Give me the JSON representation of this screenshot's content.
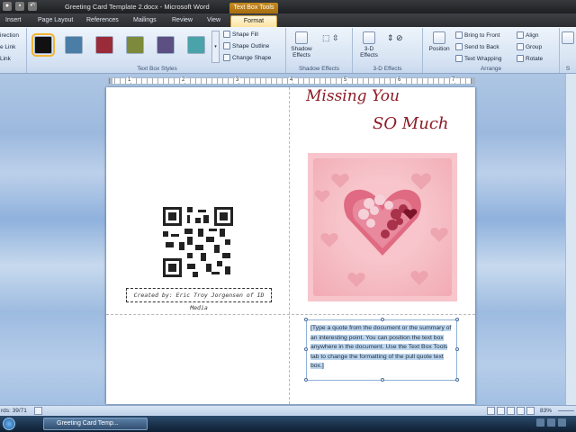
{
  "window": {
    "title": "Greeting Card Template 2.docx - Microsoft Word",
    "contextual_tab": "Text Box Tools"
  },
  "tabs": [
    {
      "label": "Insert"
    },
    {
      "label": "Page Layout"
    },
    {
      "label": "References"
    },
    {
      "label": "Mailings"
    },
    {
      "label": "Review"
    },
    {
      "label": "View"
    },
    {
      "label": "Format"
    }
  ],
  "ribbon": {
    "text_group": {
      "direction": "irection",
      "link": "e Link",
      "break_link": "Link"
    },
    "text_box_styles": {
      "label": "Text Box Styles",
      "swatches": [
        "#111111",
        "#4a7ea6",
        "#9a2c3a",
        "#7d8a3c",
        "#5c4f82",
        "#4aa3a8"
      ],
      "shape_fill": "Shape Fill",
      "shape_outline": "Shape Outline",
      "change_shape": "Change Shape"
    },
    "shadow_effects": {
      "label": "Shadow Effects",
      "button": "Shadow Effects"
    },
    "three_d_effects": {
      "label": "3-D Effects",
      "button": "3-D Effects"
    },
    "arrange": {
      "label": "Arrange",
      "position": "Position",
      "bring_to_front": "Bring to Front",
      "send_to_back": "Send to Back",
      "text_wrapping": "Text Wrapping",
      "align": "Align",
      "group": "Group",
      "rotate": "Rotate"
    },
    "size_cutoff": "S"
  },
  "ruler": {
    "numbers": [
      "1",
      "2",
      "3",
      "4",
      "5",
      "6",
      "7"
    ]
  },
  "document": {
    "title_line1": "Missing You",
    "title_line2": "SO Much",
    "credit": "Created by: Eric Troy Jorgensen of ID Media",
    "quote": "[Type a quote from the document or the summary of an interesting point. You can position the text box anywhere in the document. Use the Text Box Tools tab to change the formatting of the pull quote text box.]"
  },
  "status": {
    "words": "rds: 39/71",
    "zoom": "83%"
  },
  "taskbar": {
    "item": "Greeting Card Temp..."
  },
  "colors": {
    "accent_tab": "#fde3a0",
    "title_red": "#8d1a25",
    "heart_pink": "#f7c5cb"
  }
}
